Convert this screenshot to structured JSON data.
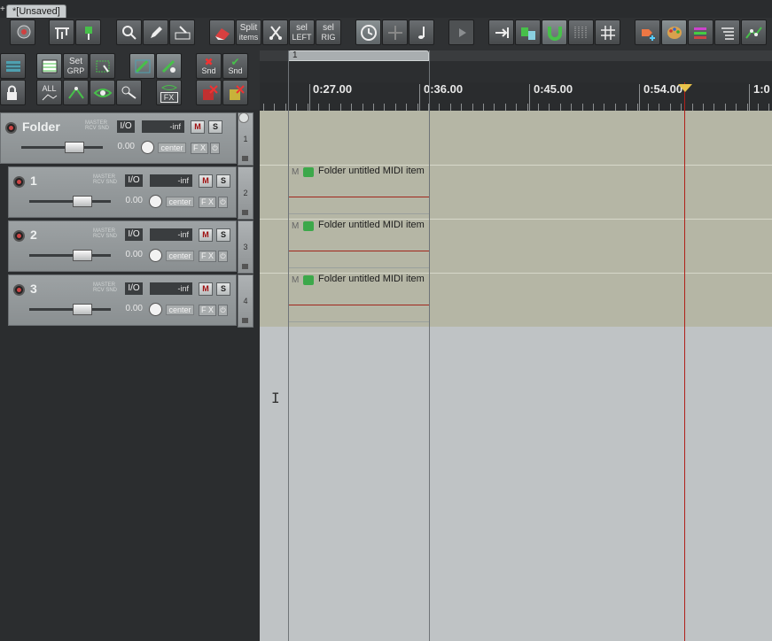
{
  "window": {
    "tab_title": "*[Unsaved]",
    "tab_prefix": "+"
  },
  "toolbar": {
    "split_items": {
      "line1": "Split",
      "line2": "items"
    },
    "sel_left": {
      "line1": "sel",
      "line2": "LEFT"
    },
    "sel_right": {
      "line1": "sel",
      "line2": "RIG"
    },
    "set_grp": {
      "line1": "Set",
      "line2": "GRP"
    },
    "all_label": "ALL",
    "fx_label": "FX",
    "snd_label": "Snd"
  },
  "ruler": {
    "region_number": "1",
    "ticks": [
      "0:27.00",
      "0:36.00",
      "0:45.00",
      "0:54.00",
      "1:0"
    ]
  },
  "tracks": [
    {
      "number": "1",
      "name": "Folder",
      "is_folder": true,
      "master_label": "MASTER",
      "rcv_label": "RCV SND",
      "io": "I/O",
      "volume_readout": "-inf",
      "mute": "M",
      "solo": "S",
      "fader_value": "0.00",
      "pan": "center",
      "fx": "F X",
      "item": null
    },
    {
      "number": "2",
      "name": "1",
      "is_folder": false,
      "master_label": "MASTER",
      "rcv_label": "RCV SND",
      "io": "I/O",
      "volume_readout": "-inf",
      "mute": "M",
      "solo": "S",
      "fader_value": "0.00",
      "pan": "center",
      "fx": "F X",
      "item": {
        "mute_label": "M",
        "name": "Folder untitled MIDI item"
      }
    },
    {
      "number": "3",
      "name": "2",
      "is_folder": false,
      "master_label": "MASTER",
      "rcv_label": "RCV SND",
      "io": "I/O",
      "volume_readout": "-inf",
      "mute": "M",
      "solo": "S",
      "fader_value": "0.00",
      "pan": "center",
      "fx": "F X",
      "item": {
        "mute_label": "M",
        "name": "Folder untitled MIDI item"
      }
    },
    {
      "number": "4",
      "name": "3",
      "is_folder": false,
      "master_label": "MASTER",
      "rcv_label": "RCV SND",
      "io": "I/O",
      "volume_readout": "-inf",
      "mute": "M",
      "solo": "S",
      "fader_value": "0.00",
      "pan": "center",
      "fx": "F X",
      "item": {
        "mute_label": "M",
        "name": "Folder untitled MIDI item"
      }
    }
  ],
  "colors": {
    "track_lane": "#b5b6a5",
    "empty_area": "#bfc3c5",
    "edit_cursor": "#b0201a",
    "midi_line": "#a1261c",
    "midi_icon": "#3ca84a",
    "playhead_marker": "#e8c24a"
  }
}
